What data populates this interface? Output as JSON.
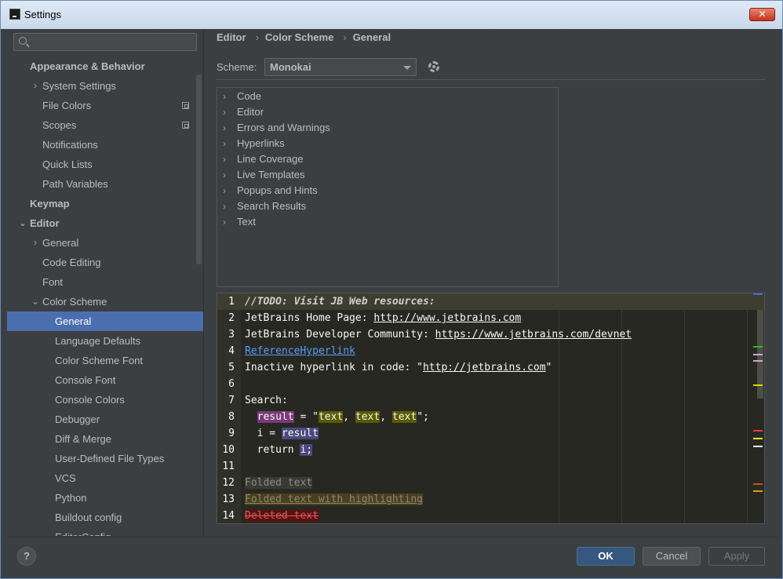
{
  "window": {
    "title": "Settings",
    "close_label": "✕"
  },
  "search": {
    "placeholder": ""
  },
  "sidebar": {
    "items": [
      {
        "label": "Appearance & Behavior",
        "level": 0,
        "bold": true,
        "arrow": ""
      },
      {
        "label": "System Settings",
        "level": 1,
        "arrow": "›"
      },
      {
        "label": "File Colors",
        "level": 1,
        "arrow": "",
        "copy": true
      },
      {
        "label": "Scopes",
        "level": 1,
        "arrow": "",
        "copy": true
      },
      {
        "label": "Notifications",
        "level": 1,
        "arrow": ""
      },
      {
        "label": "Quick Lists",
        "level": 1,
        "arrow": ""
      },
      {
        "label": "Path Variables",
        "level": 1,
        "arrow": ""
      },
      {
        "label": "Keymap",
        "level": 0,
        "bold": true,
        "arrow": ""
      },
      {
        "label": "Editor",
        "level": 0,
        "bold": true,
        "arrow": "⌄",
        "expanded": true
      },
      {
        "label": "General",
        "level": 1,
        "arrow": "›"
      },
      {
        "label": "Code Editing",
        "level": 1,
        "arrow": ""
      },
      {
        "label": "Font",
        "level": 1,
        "arrow": ""
      },
      {
        "label": "Color Scheme",
        "level": 1,
        "arrow": "⌄",
        "expanded": true
      },
      {
        "label": "General",
        "level": 2,
        "arrow": "",
        "selected": true
      },
      {
        "label": "Language Defaults",
        "level": 2,
        "arrow": ""
      },
      {
        "label": "Color Scheme Font",
        "level": 2,
        "arrow": ""
      },
      {
        "label": "Console Font",
        "level": 2,
        "arrow": ""
      },
      {
        "label": "Console Colors",
        "level": 2,
        "arrow": ""
      },
      {
        "label": "Debugger",
        "level": 2,
        "arrow": ""
      },
      {
        "label": "Diff & Merge",
        "level": 2,
        "arrow": ""
      },
      {
        "label": "User-Defined File Types",
        "level": 2,
        "arrow": ""
      },
      {
        "label": "VCS",
        "level": 2,
        "arrow": ""
      },
      {
        "label": "Python",
        "level": 2,
        "arrow": ""
      },
      {
        "label": "Buildout config",
        "level": 2,
        "arrow": ""
      },
      {
        "label": "EditorConfig",
        "level": 2,
        "arrow": ""
      }
    ]
  },
  "breadcrumb": {
    "items": [
      "Editor",
      "Color Scheme",
      "General"
    ],
    "separator": "›"
  },
  "scheme": {
    "label": "Scheme:",
    "value": "Monokai"
  },
  "categories": [
    "Code",
    "Editor",
    "Errors and Warnings",
    "Hyperlinks",
    "Line Coverage",
    "Live Templates",
    "Popups and Hints",
    "Search Results",
    "Text"
  ],
  "preview": {
    "lines": [
      {
        "n": "1",
        "segments": [
          {
            "t": "//TODO: Visit JB Web resources:",
            "c": "todo"
          }
        ]
      },
      {
        "n": "2",
        "segments": [
          {
            "t": "JetBrains Home Page: "
          },
          {
            "t": "http://www.jetbrains.com",
            "c": "link"
          }
        ]
      },
      {
        "n": "3",
        "segments": [
          {
            "t": "JetBrains Developer Community: "
          },
          {
            "t": "https://www.jetbrains.com/devnet",
            "c": "link"
          }
        ]
      },
      {
        "n": "4",
        "segments": [
          {
            "t": "ReferenceHyperlink",
            "c": "reflink"
          }
        ]
      },
      {
        "n": "5",
        "segments": [
          {
            "t": "Inactive hyperlink in code: \""
          },
          {
            "t": "http://jetbrains.com",
            "c": "link"
          },
          {
            "t": "\""
          }
        ]
      },
      {
        "n": "6",
        "segments": []
      },
      {
        "n": "7",
        "segments": [
          {
            "t": "Search:"
          }
        ]
      },
      {
        "n": "8",
        "segments": [
          {
            "t": "  "
          },
          {
            "t": "result",
            "c": "hl-p"
          },
          {
            "t": " = \""
          },
          {
            "t": "text",
            "c": "hl-y"
          },
          {
            "t": ", "
          },
          {
            "t": "text",
            "c": "hl-y"
          },
          {
            "t": ", "
          },
          {
            "t": "text",
            "c": "hl-y"
          },
          {
            "t": "\";"
          }
        ]
      },
      {
        "n": "9",
        "segments": [
          {
            "t": "  i = "
          },
          {
            "t": "result",
            "c": "hl-b"
          }
        ]
      },
      {
        "n": "10",
        "segments": [
          {
            "t": "  return "
          },
          {
            "t": "i;",
            "c": "hl-b"
          }
        ]
      },
      {
        "n": "11",
        "segments": []
      },
      {
        "n": "12",
        "segments": [
          {
            "t": "Folded text",
            "c": "folded"
          }
        ]
      },
      {
        "n": "13",
        "segments": [
          {
            "t": "Folded text with highlighting",
            "c": "folded-hl"
          }
        ]
      },
      {
        "n": "14",
        "segments": [
          {
            "t": "Deleted text",
            "c": "deleted"
          }
        ]
      }
    ],
    "stripe_colors": [
      "#3d6cde",
      "#26bd2a",
      "#c9a5d8",
      "#c9a5d8",
      "#d6d600",
      "#e83a3a",
      "#e8e820",
      "#e8e8e8",
      "#c8502a",
      "#e0a000"
    ]
  },
  "footer": {
    "help": "?",
    "ok": "OK",
    "cancel": "Cancel",
    "apply": "Apply"
  }
}
